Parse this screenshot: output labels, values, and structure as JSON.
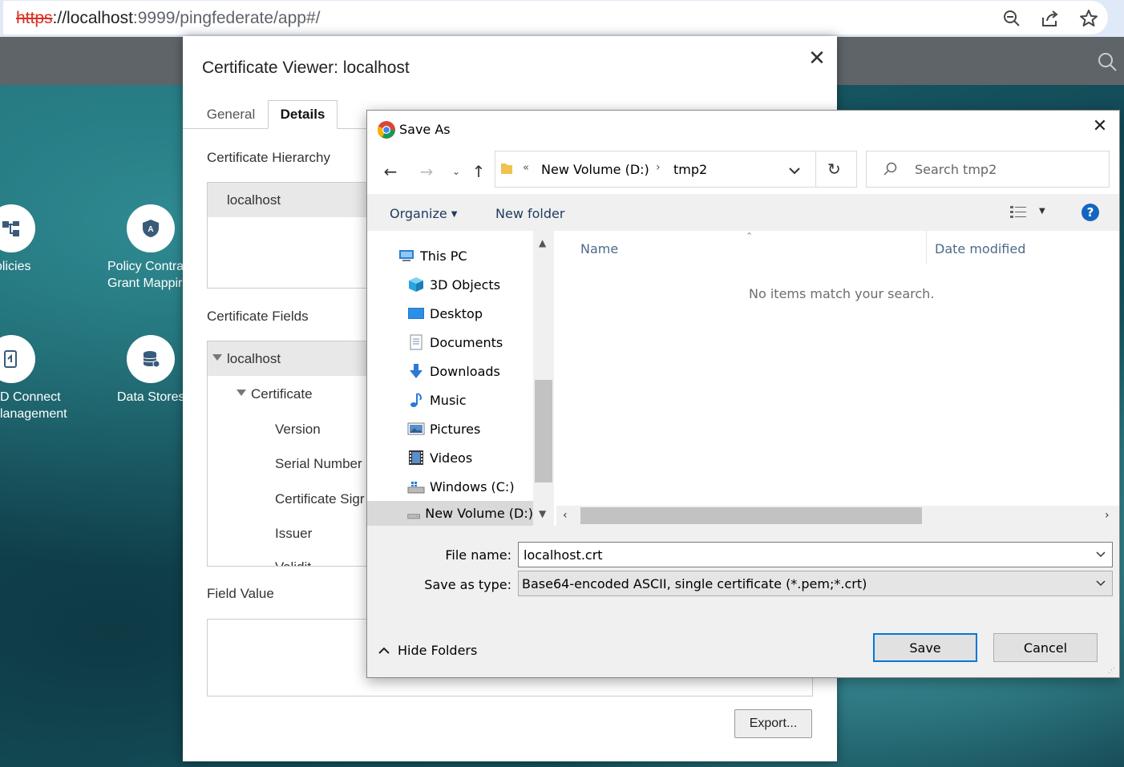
{
  "browser": {
    "url_scheme": "https",
    "url_host": "://localhost",
    "url_rest": ":9999/pingfederate/app#/"
  },
  "app": {
    "tiles": [
      {
        "label_line1": "olicies",
        "label_line2": ""
      },
      {
        "label_line1": "Policy Contra",
        "label_line2": "Grant Mappir"
      },
      {
        "label_line1": "D Connect",
        "label_line2": "lanagement"
      },
      {
        "label_line1": "Data Stores",
        "label_line2": ""
      }
    ]
  },
  "cert_viewer": {
    "title": "Certificate Viewer: localhost",
    "tabs": [
      "General",
      "Details"
    ],
    "hierarchy_label": "Certificate Hierarchy",
    "hierarchy_item": "localhost",
    "fields_label": "Certificate Fields",
    "fields_tree": {
      "root": "localhost",
      "child": "Certificate",
      "items": [
        "Version",
        "Serial Number",
        "Certificate Sigr",
        "Issuer",
        "Validit"
      ]
    },
    "field_value_label": "Field Value",
    "export_label": "Export..."
  },
  "save_dialog": {
    "title": "Save As",
    "path_prefix": "«",
    "path_parts": [
      "New Volume (D:)",
      "tmp2"
    ],
    "search_placeholder": "Search tmp2",
    "organize_label": "Organize",
    "new_folder_label": "New folder",
    "nav_items": [
      "This PC",
      "3D Objects",
      "Desktop",
      "Documents",
      "Downloads",
      "Music",
      "Pictures",
      "Videos",
      "Windows (C:)",
      "New Volume (D:)"
    ],
    "columns": [
      "Name",
      "Date modified"
    ],
    "empty_message": "No items match your search.",
    "file_name_label": "File name:",
    "file_name_value": "localhost.crt",
    "save_type_label": "Save as type:",
    "save_type_value": "Base64-encoded ASCII, single certificate (*.pem;*.crt)",
    "hide_folders_label": "Hide Folders",
    "save_label": "Save",
    "cancel_label": "Cancel",
    "help_glyph": "?"
  }
}
